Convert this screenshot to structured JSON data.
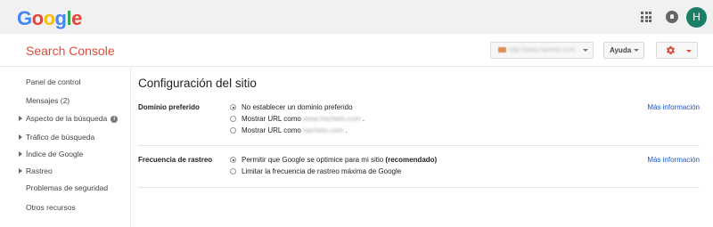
{
  "header": {
    "logo_letters": [
      {
        "char": "G",
        "color": "#4285f4"
      },
      {
        "char": "o",
        "color": "#ea4335"
      },
      {
        "char": "o",
        "color": "#fbbc05"
      },
      {
        "char": "g",
        "color": "#4285f4"
      },
      {
        "char": "l",
        "color": "#34a853"
      },
      {
        "char": "e",
        "color": "#ea4335"
      }
    ],
    "apps_icon": "apps-grid-icon",
    "notifications_icon": "bell-icon",
    "avatar_initial": "H",
    "avatar_color": "#1a7f64"
  },
  "subheader": {
    "product_title": "Search Console",
    "site_selector_value": "http://www.hacheto.com",
    "help_label": "Ayuda",
    "settings_icon": "gear-icon",
    "accent_color": "#dd4b39"
  },
  "sidebar": {
    "items": [
      {
        "label": "Panel de control",
        "expandable": false
      },
      {
        "label": "Mensajes (2)",
        "expandable": false
      },
      {
        "label": "Aspecto de la búsqueda",
        "expandable": true,
        "info": "i"
      },
      {
        "label": "Tráfico de búsqueda",
        "expandable": true
      },
      {
        "label": "Índice de Google",
        "expandable": true
      },
      {
        "label": "Rastreo",
        "expandable": true
      },
      {
        "label": "Problemas de seguridad",
        "expandable": false
      },
      {
        "label": "Otros recursos",
        "expandable": false
      }
    ]
  },
  "main": {
    "title": "Configuración del sitio",
    "preferred_domain": {
      "label": "Dominio preferido",
      "more_info": "Más información",
      "options": [
        {
          "text": "No establecer un dominio preferido",
          "checked": true
        },
        {
          "text": "Mostrar URL como",
          "blurred": "www.hacheto.com",
          "suffix": ".",
          "checked": false
        },
        {
          "text": "Mostrar URL como",
          "blurred": "hacheto.com",
          "suffix": ".",
          "checked": false
        }
      ]
    },
    "crawl_rate": {
      "label": "Frecuencia de rastreo",
      "more_info": "Más información",
      "options": [
        {
          "text": "Permitir que Google se optimice para mi sitio",
          "bold": "(recomendado)",
          "checked": true
        },
        {
          "text": "Limitar la frecuencia de rastreo máxima de Google",
          "checked": false
        }
      ]
    }
  }
}
